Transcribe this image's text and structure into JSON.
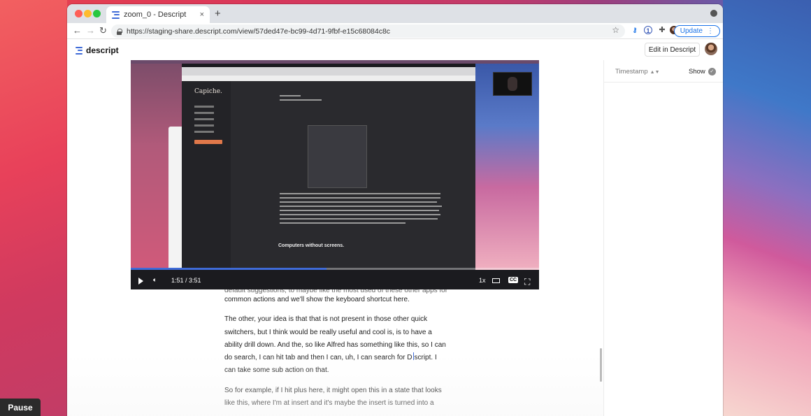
{
  "browser": {
    "tab_title": "zoom_0 - Descript",
    "tab_close": "×",
    "new_tab": "+",
    "url": "https://staging-share.descript.com/view/57ded47e-bc99-4d71-9fbf-e15c68084c8c",
    "update_label": "Update",
    "nav": {
      "back": "←",
      "forward": "→",
      "reload": "↻",
      "star": "☆",
      "menu": "⋮"
    }
  },
  "app": {
    "logo_text": "descript",
    "edit_button": "Edit in Descript",
    "accent": "#3f6bd8"
  },
  "sidebar": {
    "timestamp_label": "Timestamp",
    "show_label": "Show"
  },
  "player": {
    "time": "1:51 / 3:51",
    "speed": "1x",
    "cc": "CC",
    "progress": 0.48,
    "inner": {
      "logo": "Capiche.",
      "heading": "Computers without screens."
    }
  },
  "transcript": {
    "cut_line": "default suggestions, to maybe like the most used of these other apps for",
    "p1": "common actions and we'll show the keyboard shortcut here.",
    "p2_before_cursor": "The other, your idea is that that is not present in those other quick switchers, but I think would be really useful and cool is, is to have a ability drill down. And the, so like Alfred has something like this, so I can do search, I can hit tab and then I can, uh, I can search for D",
    "p2_after_cursor": "script. I can take some sub action on that.",
    "p3": "So for example, if I hit plus here, it might open this in a state that looks like this, where I'm at insert and it's maybe the insert is turned into a"
  },
  "overlay": {
    "pause_label": "Pause"
  }
}
